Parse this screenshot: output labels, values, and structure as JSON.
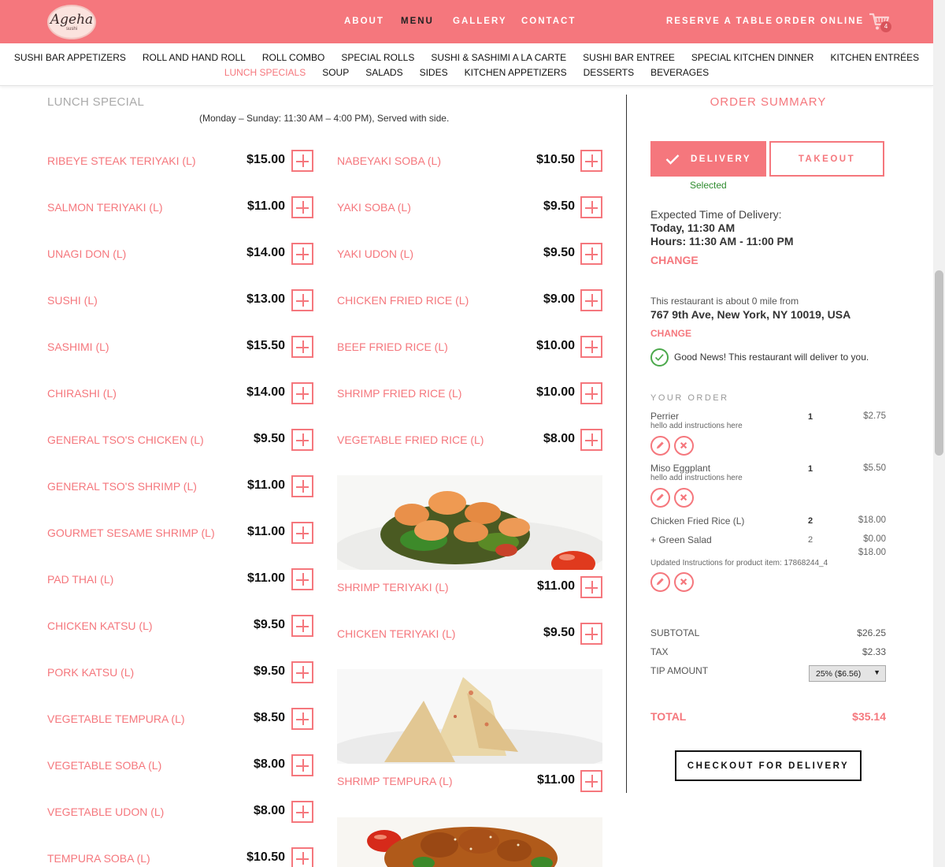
{
  "header": {
    "logo_text": "Ageha",
    "logo_sub": "sushi",
    "nav": {
      "about": "ABOUT",
      "menu": "MENU",
      "gallery": "GALLERY",
      "contact": "CONTACT"
    },
    "reserve": "RESERVE A TABLE",
    "order_online": "ORDER ONLINE",
    "cart_count": "4"
  },
  "categories": {
    "row1": [
      "SUSHI BAR APPETIZERS",
      "ROLL AND HAND ROLL",
      "ROLL COMBO",
      "SPECIAL ROLLS",
      "SUSHI & SASHIMI A LA CARTE",
      "SUSHI BAR ENTREE",
      "SPECIAL KITCHEN DINNER",
      "KITCHEN ENTRÉES"
    ],
    "row2": [
      "LUNCH SPECIALS",
      "SOUP",
      "SALADS",
      "SIDES",
      "KITCHEN APPETIZERS",
      "DESSERTS",
      "BEVERAGES"
    ],
    "active": "LUNCH SPECIALS"
  },
  "section": {
    "title": "LUNCH SPECIAL",
    "note": "(Monday – Sunday: 11:30 AM – 4:00 PM), Served with side."
  },
  "menu_left": [
    {
      "name": "RIBEYE STEAK TERIYAKI (L)",
      "price": "$15.00"
    },
    {
      "name": "SALMON TERIYAKI (L)",
      "price": "$11.00"
    },
    {
      "name": "UNAGI DON (L)",
      "price": "$14.00"
    },
    {
      "name": "SUSHI (L)",
      "price": "$13.00"
    },
    {
      "name": "SASHIMI (L)",
      "price": "$15.50"
    },
    {
      "name": "CHIRASHI (L)",
      "price": "$14.00"
    },
    {
      "name": "GENERAL TSO'S CHICKEN (L)",
      "price": "$9.50"
    },
    {
      "name": "GENERAL TSO'S SHRIMP (L)",
      "price": "$11.00"
    },
    {
      "name": "GOURMET SESAME SHRIMP (L)",
      "price": "$11.00"
    },
    {
      "name": "PAD THAI (L)",
      "price": "$11.00"
    },
    {
      "name": "CHICKEN KATSU (L)",
      "price": "$9.50"
    },
    {
      "name": "PORK KATSU (L)",
      "price": "$9.50"
    },
    {
      "name": "VEGETABLE TEMPURA (L)",
      "price": "$8.50"
    },
    {
      "name": "VEGETABLE SOBA (L)",
      "price": "$8.00"
    },
    {
      "name": "VEGETABLE UDON (L)",
      "price": "$8.00"
    },
    {
      "name": "TEMPURA SOBA (L)",
      "price": "$10.50"
    }
  ],
  "menu_right": [
    {
      "name": "NABEYAKI SOBA (L)",
      "price": "$10.50"
    },
    {
      "name": "YAKI SOBA (L)",
      "price": "$9.50"
    },
    {
      "name": "YAKI UDON (L)",
      "price": "$9.50"
    },
    {
      "name": "CHICKEN FRIED RICE (L)",
      "price": "$9.00"
    },
    {
      "name": "BEEF FRIED RICE (L)",
      "price": "$10.00"
    },
    {
      "name": "SHRIMP FRIED RICE (L)",
      "price": "$10.00"
    },
    {
      "name": "VEGETABLE FRIED RICE (L)",
      "price": "$8.00"
    },
    {
      "name": "SHRIMP TERIYAKI (L)",
      "price": "$11.00"
    },
    {
      "name": "CHICKEN TERIYAKI (L)",
      "price": "$9.50"
    },
    {
      "name": "SHRIMP TEMPURA (L)",
      "price": "$11.00"
    }
  ],
  "summary": {
    "title": "ORDER SUMMARY",
    "delivery": "DELIVERY",
    "takeout": "TAKEOUT",
    "selected": "Selected",
    "expected_label": "Expected Time of Delivery:",
    "today": "Today, 11:30 AM",
    "hours": "Hours: 11:30 AM - 11:00 PM",
    "change": "CHANGE",
    "distance": "This restaurant is about 0 mile from",
    "address": "767 9th Ave, New York, NY 10019, USA",
    "change2": "CHANGE",
    "good_news": "Good News! This restaurant will deliver to you.",
    "your_order": "YOUR ORDER",
    "items": [
      {
        "name": "Perrier",
        "note": "hello add instructions here",
        "qty": "1",
        "price": "$2.75"
      },
      {
        "name": "Miso Eggplant",
        "note": "hello add instructions here",
        "qty": "1",
        "price": "$5.50"
      },
      {
        "name": "Chicken Fried Rice (L)",
        "qty": "2",
        "price": "$18.00",
        "side": "+ Green Salad",
        "side_qty": "2",
        "side_price": "$0.00",
        "line_total": "$18.00",
        "note": "Updated Instructions for product item: 17868244_4"
      }
    ],
    "subtotal_label": "SUBTOTAL",
    "subtotal": "$26.25",
    "tax_label": "TAX",
    "tax": "$2.33",
    "tip_label": "TIP AMOUNT",
    "tip_selected": "25% ($6.56)",
    "total_label": "TOTAL",
    "total": "$35.14",
    "checkout": "CHECKOUT FOR DELIVERY"
  },
  "colors": {
    "brand": "#f5777d",
    "success": "#4aa84a"
  }
}
